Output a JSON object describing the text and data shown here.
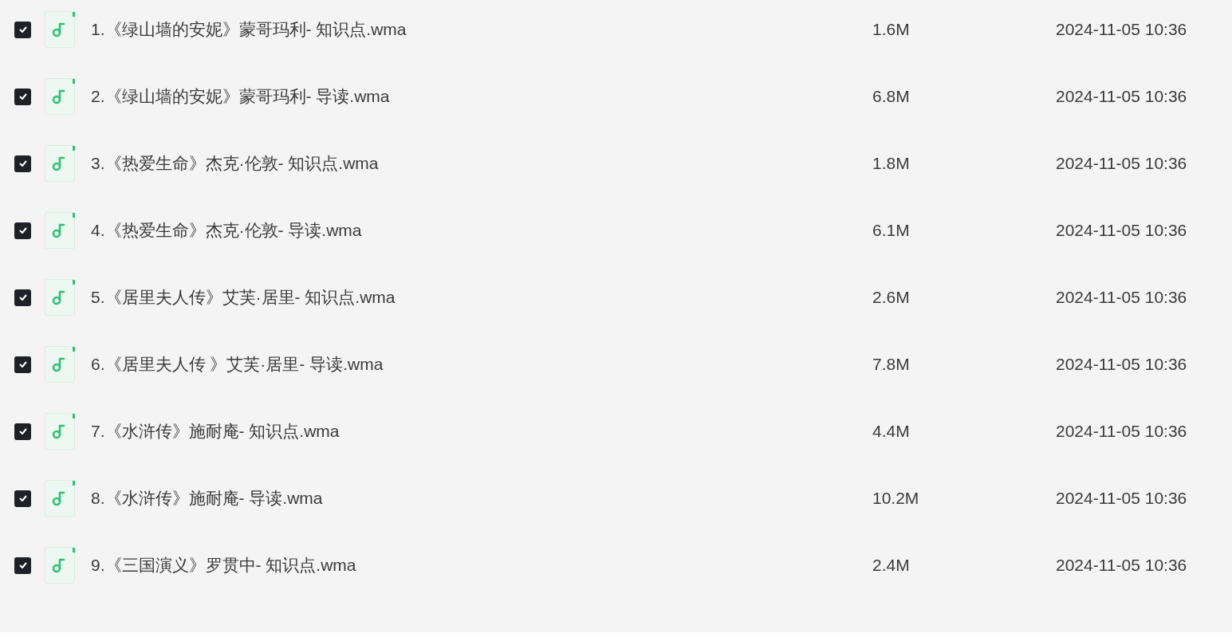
{
  "files": [
    {
      "checked": true,
      "name": "1.《绿山墙的安妮》蒙哥玛利- 知识点.wma",
      "size": "1.6M",
      "modified": "2024-11-05 10:36"
    },
    {
      "checked": true,
      "name": "2.《绿山墙的安妮》蒙哥玛利- 导读.wma",
      "size": "6.8M",
      "modified": "2024-11-05 10:36"
    },
    {
      "checked": true,
      "name": "3.《热爱生命》杰克·伦敦- 知识点.wma",
      "size": "1.8M",
      "modified": "2024-11-05 10:36"
    },
    {
      "checked": true,
      "name": "4.《热爱生命》杰克·伦敦- 导读.wma",
      "size": "6.1M",
      "modified": "2024-11-05 10:36"
    },
    {
      "checked": true,
      "name": "5.《居里夫人传》艾芙·居里- 知识点.wma",
      "size": "2.6M",
      "modified": "2024-11-05 10:36"
    },
    {
      "checked": true,
      "name": "6.《居里夫人传 》艾芙·居里- 导读.wma",
      "size": "7.8M",
      "modified": "2024-11-05 10:36"
    },
    {
      "checked": true,
      "name": "7.《水浒传》施耐庵- 知识点.wma",
      "size": "4.4M",
      "modified": "2024-11-05 10:36"
    },
    {
      "checked": true,
      "name": "8.《水浒传》施耐庵- 导读.wma",
      "size": "10.2M",
      "modified": "2024-11-05 10:36"
    },
    {
      "checked": true,
      "name": "9.《三国演义》罗贯中- 知识点.wma",
      "size": "2.4M",
      "modified": "2024-11-05 10:36"
    }
  ]
}
